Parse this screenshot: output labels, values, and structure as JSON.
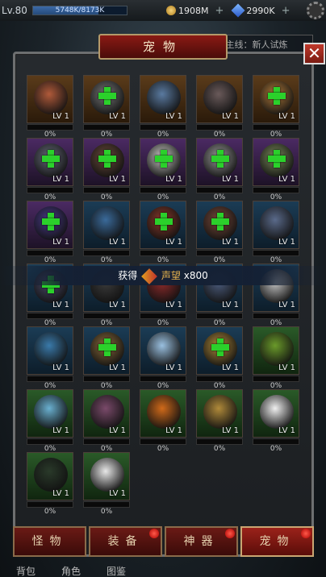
{
  "topbar": {
    "level": "Lv.80",
    "exp_text": "5748K/8173K",
    "exp_fraction": 0.7,
    "gold": "1908M",
    "gems": "2990K"
  },
  "quest": {
    "text": "主线：新人试炼"
  },
  "panel": {
    "title": "宠物",
    "close_label": "✕"
  },
  "toast": {
    "prefix": "获得",
    "item": "声望",
    "amount": "x800"
  },
  "pets": [
    {
      "lv": "LV 1",
      "pct": "0%",
      "frame": "gold",
      "add": false,
      "color": "#b05a3a"
    },
    {
      "lv": "LV 1",
      "pct": "0%",
      "frame": "gold",
      "add": true,
      "color": "#777777"
    },
    {
      "lv": "LV 1",
      "pct": "0%",
      "frame": "gold",
      "add": false,
      "color": "#5a7aa0"
    },
    {
      "lv": "LV 1",
      "pct": "0%",
      "frame": "gold",
      "add": false,
      "color": "#6a5a5a"
    },
    {
      "lv": "LV 1",
      "pct": "0%",
      "frame": "gold",
      "add": true,
      "color": "#b07a3a"
    },
    {
      "lv": "LV 1",
      "pct": "0%",
      "frame": "purple",
      "add": true,
      "color": "#666a7a"
    },
    {
      "lv": "LV 1",
      "pct": "0%",
      "frame": "purple",
      "add": true,
      "color": "#6a4a3a"
    },
    {
      "lv": "LV 1",
      "pct": "0%",
      "frame": "purple",
      "add": true,
      "color": "#ccccc8"
    },
    {
      "lv": "LV 1",
      "pct": "0%",
      "frame": "purple",
      "add": true,
      "color": "#9a9a9a"
    },
    {
      "lv": "LV 1",
      "pct": "0%",
      "frame": "purple",
      "add": true,
      "color": "#7a8a5a"
    },
    {
      "lv": "LV 1",
      "pct": "0%",
      "frame": "purple",
      "add": true,
      "color": "#4a3a8a"
    },
    {
      "lv": "LV 1",
      "pct": "0%",
      "frame": "blue",
      "add": false,
      "color": "#3a6a9a"
    },
    {
      "lv": "LV 1",
      "pct": "0%",
      "frame": "blue",
      "add": true,
      "color": "#8a3a2a"
    },
    {
      "lv": "LV 1",
      "pct": "0%",
      "frame": "blue",
      "add": true,
      "color": "#7a4a3a"
    },
    {
      "lv": "LV 1",
      "pct": "0%",
      "frame": "blue",
      "add": false,
      "color": "#5a6a8a"
    },
    {
      "lv": "LV 1",
      "pct": "0%",
      "frame": "blue",
      "add": true,
      "color": "#4a4a6a"
    },
    {
      "lv": "LV 1",
      "pct": "0%",
      "frame": "blue",
      "add": false,
      "color": "#3a3a3a"
    },
    {
      "lv": "LV 1",
      "pct": "0%",
      "frame": "blue",
      "add": false,
      "color": "#8a2a2a"
    },
    {
      "lv": "LV 1",
      "pct": "0%",
      "frame": "blue",
      "add": false,
      "color": "#4a5a7a"
    },
    {
      "lv": "LV 1",
      "pct": "0%",
      "frame": "blue",
      "add": false,
      "color": "#c0c0c0"
    },
    {
      "lv": "LV 1",
      "pct": "0%",
      "frame": "blue",
      "add": false,
      "color": "#3a7aaa"
    },
    {
      "lv": "LV 1",
      "pct": "0%",
      "frame": "blue",
      "add": true,
      "color": "#8a6a3a"
    },
    {
      "lv": "LV 1",
      "pct": "0%",
      "frame": "blue",
      "add": false,
      "color": "#9ac0e0"
    },
    {
      "lv": "LV 1",
      "pct": "0%",
      "frame": "blue",
      "add": true,
      "color": "#b08a3a"
    },
    {
      "lv": "LV 1",
      "pct": "0%",
      "frame": "green",
      "add": false,
      "color": "#6a9a2a"
    },
    {
      "lv": "LV 1",
      "pct": "0%",
      "frame": "green",
      "add": false,
      "color": "#6ab0d0"
    },
    {
      "lv": "LV 1",
      "pct": "0%",
      "frame": "green",
      "add": false,
      "color": "#7a4a6a"
    },
    {
      "lv": "LV 1",
      "pct": "0%",
      "frame": "green",
      "add": false,
      "color": "#d06a1a"
    },
    {
      "lv": "LV 1",
      "pct": "0%",
      "frame": "green",
      "add": false,
      "color": "#b08a3a"
    },
    {
      "lv": "LV 1",
      "pct": "0%",
      "frame": "green",
      "add": false,
      "color": "#f0f0f0"
    },
    {
      "lv": "LV 1",
      "pct": "0%",
      "frame": "green",
      "add": false,
      "color": "#2a3a2a"
    },
    {
      "lv": "LV 1",
      "pct": "0%",
      "frame": "green",
      "add": false,
      "color": "#e8e8e8"
    }
  ],
  "tabs": [
    {
      "label": "怪物",
      "active": false,
      "badge": false
    },
    {
      "label": "装备",
      "active": false,
      "badge": true
    },
    {
      "label": "神器",
      "active": false,
      "badge": true
    },
    {
      "label": "宠物",
      "active": true,
      "badge": true
    }
  ],
  "bottomnav": [
    "背包",
    "角色",
    "图鉴"
  ]
}
